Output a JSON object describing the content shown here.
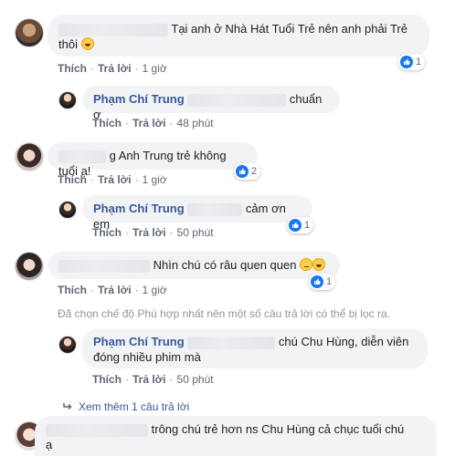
{
  "comments": [
    {
      "text": "Tại anh ở Nhà Hát Tuổi Trẻ nên anh phải Trẻ",
      "text2": "thôi",
      "like": "Thích",
      "reply": "Trả lời",
      "time": "1 giờ",
      "reactions": "1"
    },
    {
      "name": "Phạm Chí Trung",
      "text": "chuẩn ợ",
      "like": "Thích",
      "reply": "Trả lời",
      "time": "48 phút"
    },
    {
      "text": "g Anh Trung trẻ không tuổi ạ!",
      "like": "Thích",
      "reply": "Trả lời",
      "time": "1 giờ",
      "reactions": "2"
    },
    {
      "name": "Phạm Chí Trung",
      "text": "cảm ơn em",
      "like": "Thích",
      "reply": "Trả lời",
      "time": "50 phút",
      "reactions": "1"
    },
    {
      "text": "Nhìn chú có râu quen quen",
      "like": "Thích",
      "reply": "Trả lời",
      "time": "1 giờ",
      "reactions": "1"
    },
    {
      "name": "Phạm Chí Trung",
      "text": "chú Chu Hùng, diễn viên",
      "text2": "đóng nhiều phim mà",
      "like": "Thích",
      "reply": "Trả lời",
      "time": "50 phút"
    },
    {
      "text": "trông chú trẻ hơn ns Chu Hùng cả chục tuổi chú",
      "text2": "ạ"
    }
  ],
  "filter_notice": "Đã chọn chế độ Phù hợp nhất nên một số câu trả lời có thể bị lọc ra.",
  "see_more": "Xem thêm 1 câu trả lời",
  "colors": {
    "link": "#385898",
    "bubble": "#f2f3f5",
    "like_blue": "#1877f2"
  },
  "icons": [
    "like-icon",
    "laugh-emoji-icon",
    "thinking-emoji-icon",
    "reply-arrow-icon"
  ]
}
